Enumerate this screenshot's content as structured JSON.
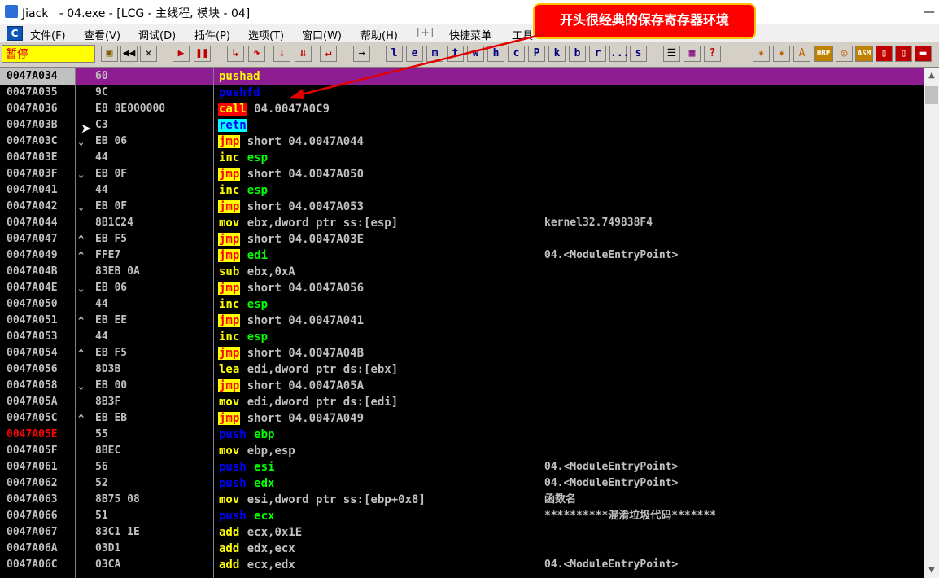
{
  "window": {
    "title": "Jiack   - 04.exe - [LCG - 主线程, 模块 - 04]"
  },
  "menu": {
    "logo": "C",
    "items": [
      "文件(F)",
      "查看(V)",
      "调试(D)",
      "插件(P)",
      "选项(T)",
      "窗口(W)",
      "帮助(H)",
      "[+]",
      "快捷菜单",
      "工具"
    ]
  },
  "toolbar": {
    "state": "暂停",
    "buttons": [
      "l",
      "e",
      "m",
      "t",
      "w",
      "h",
      "c",
      "P",
      "k",
      "b",
      "r",
      "...",
      "s"
    ],
    "right_buttons": [
      "HBP",
      "ASM"
    ]
  },
  "annotation": {
    "text": "开头很经典的保存寄存器环境"
  },
  "colors": {
    "selected_row": "#8e1c93",
    "annotation_bg": "#ff0000",
    "annotation_border": "#ffc000"
  },
  "rows": [
    {
      "addr": "0047A034",
      "jump": "",
      "hex": "60",
      "mnemonic": "pushad",
      "operands": "",
      "comment": ""
    },
    {
      "addr": "0047A035",
      "jump": "",
      "hex": "9C",
      "mnemonic": "pushfd",
      "operands": "",
      "comment": ""
    },
    {
      "addr": "0047A036",
      "jump": "",
      "hex": "E8 8E000000",
      "mnemonic": "call",
      "operands": "04.0047A0C9",
      "comment": ""
    },
    {
      "addr": "0047A03B",
      "jump": "",
      "hex": "C3",
      "mnemonic": "retn",
      "operands": "",
      "comment": ""
    },
    {
      "addr": "0047A03C",
      "jump": "⌄",
      "hex": "EB 06",
      "mnemonic": "jmp",
      "operands": "short 04.0047A044",
      "comment": ""
    },
    {
      "addr": "0047A03E",
      "jump": "",
      "hex": "44",
      "mnemonic": "inc",
      "operands": "esp",
      "comment": ""
    },
    {
      "addr": "0047A03F",
      "jump": "⌄",
      "hex": "EB 0F",
      "mnemonic": "jmp",
      "operands": "short 04.0047A050",
      "comment": ""
    },
    {
      "addr": "0047A041",
      "jump": "",
      "hex": "44",
      "mnemonic": "inc",
      "operands": "esp",
      "comment": ""
    },
    {
      "addr": "0047A042",
      "jump": "⌄",
      "hex": "EB 0F",
      "mnemonic": "jmp",
      "operands": "short 04.0047A053",
      "comment": ""
    },
    {
      "addr": "0047A044",
      "jump": "",
      "hex": "8B1C24",
      "mnemonic": "mov",
      "operands": "ebx,dword ptr ss:[esp]",
      "comment": "kernel32.749838F4"
    },
    {
      "addr": "0047A047",
      "jump": "^",
      "hex": "EB F5",
      "mnemonic": "jmp",
      "operands": "short 04.0047A03E",
      "comment": ""
    },
    {
      "addr": "0047A049",
      "jump": "^",
      "hex": "FFE7",
      "mnemonic": "jmp",
      "operands": "edi",
      "comment": "04.<ModuleEntryPoint>"
    },
    {
      "addr": "0047A04B",
      "jump": "",
      "hex": "83EB 0A",
      "mnemonic": "sub",
      "operands": "ebx,0xA",
      "comment": ""
    },
    {
      "addr": "0047A04E",
      "jump": "⌄",
      "hex": "EB 06",
      "mnemonic": "jmp",
      "operands": "short 04.0047A056",
      "comment": ""
    },
    {
      "addr": "0047A050",
      "jump": "",
      "hex": "44",
      "mnemonic": "inc",
      "operands": "esp",
      "comment": ""
    },
    {
      "addr": "0047A051",
      "jump": "^",
      "hex": "EB EE",
      "mnemonic": "jmp",
      "operands": "short 04.0047A041",
      "comment": ""
    },
    {
      "addr": "0047A053",
      "jump": "",
      "hex": "44",
      "mnemonic": "inc",
      "operands": "esp",
      "comment": ""
    },
    {
      "addr": "0047A054",
      "jump": "^",
      "hex": "EB F5",
      "mnemonic": "jmp",
      "operands": "short 04.0047A04B",
      "comment": ""
    },
    {
      "addr": "0047A056",
      "jump": "",
      "hex": "8D3B",
      "mnemonic": "lea",
      "operands": "edi,dword ptr ds:[ebx]",
      "comment": ""
    },
    {
      "addr": "0047A058",
      "jump": "⌄",
      "hex": "EB 00",
      "mnemonic": "jmp",
      "operands": "short 04.0047A05A",
      "comment": ""
    },
    {
      "addr": "0047A05A",
      "jump": "",
      "hex": "8B3F",
      "mnemonic": "mov",
      "operands": "edi,dword ptr ds:[edi]",
      "comment": ""
    },
    {
      "addr": "0047A05C",
      "jump": "^",
      "hex": "EB EB",
      "mnemonic": "jmp",
      "operands": "short 04.0047A049",
      "comment": ""
    },
    {
      "addr": "0047A05E",
      "jump": "",
      "hex": "55",
      "mnemonic": "push",
      "operands": "ebp",
      "comment": "",
      "breakpoint": true
    },
    {
      "addr": "0047A05F",
      "jump": "",
      "hex": "8BEC",
      "mnemonic": "mov",
      "operands": "ebp,esp",
      "comment": ""
    },
    {
      "addr": "0047A061",
      "jump": "",
      "hex": "56",
      "mnemonic": "push",
      "operands": "esi",
      "comment": "04.<ModuleEntryPoint>"
    },
    {
      "addr": "0047A062",
      "jump": "",
      "hex": "52",
      "mnemonic": "push",
      "operands": "edx",
      "comment": "04.<ModuleEntryPoint>"
    },
    {
      "addr": "0047A063",
      "jump": "",
      "hex": "8B75 08",
      "mnemonic": "mov",
      "operands": "esi,dword ptr ss:[ebp+0x8]",
      "comment": "函数名"
    },
    {
      "addr": "0047A066",
      "jump": "",
      "hex": "51",
      "mnemonic": "push",
      "operands": "ecx",
      "comment": "**********混淆垃圾代码*******"
    },
    {
      "addr": "0047A067",
      "jump": "",
      "hex": "83C1 1E",
      "mnemonic": "add",
      "operands": "ecx,0x1E",
      "comment": ""
    },
    {
      "addr": "0047A06A",
      "jump": "",
      "hex": "03D1",
      "mnemonic": "add",
      "operands": "edx,ecx",
      "comment": ""
    },
    {
      "addr": "0047A06C",
      "jump": "",
      "hex": "03CA",
      "mnemonic": "add",
      "operands": "ecx,edx",
      "comment": "04.<ModuleEntryPoint>"
    }
  ]
}
